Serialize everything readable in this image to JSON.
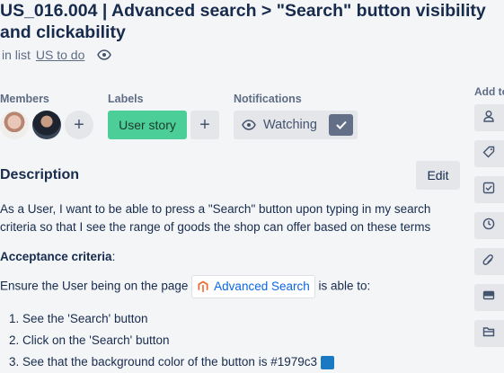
{
  "card": {
    "title": "US_016.004 | Advanced search > \"Search\" button visibility and clickability",
    "in_list_prefix": "in list",
    "list_name": "US to do"
  },
  "members": {
    "label": "Members",
    "add": "+"
  },
  "labels": {
    "label": "Labels",
    "items": [
      "User story"
    ],
    "add": "+",
    "color": "#4bce97"
  },
  "notifications": {
    "label": "Notifications",
    "watch_label": "Watching"
  },
  "description": {
    "title": "Description",
    "edit": "Edit",
    "p1": "As a User, I want to be able to press a \"Search\" button upon typing in my search criteria so that I see the range of goods the shop can offer based on these terms",
    "ac_heading": "Acceptance criteria",
    "ac_suffix": ":",
    "ensure_prefix": "Ensure the User being on the page",
    "link_label": "Advanced Search",
    "ensure_suffix": "is able to:",
    "list": [
      "1. See the 'Search' button",
      "2. Click on the 'Search' button",
      "3. See that the background color of the button is #1979c3"
    ],
    "swatch_color": "#1979c3"
  },
  "sidebar": {
    "label": "Add to",
    "icons": [
      "person-icon",
      "tag-icon",
      "checklist-icon",
      "clock-icon",
      "paperclip-icon",
      "cover-icon",
      "custom-fields-icon"
    ]
  }
}
